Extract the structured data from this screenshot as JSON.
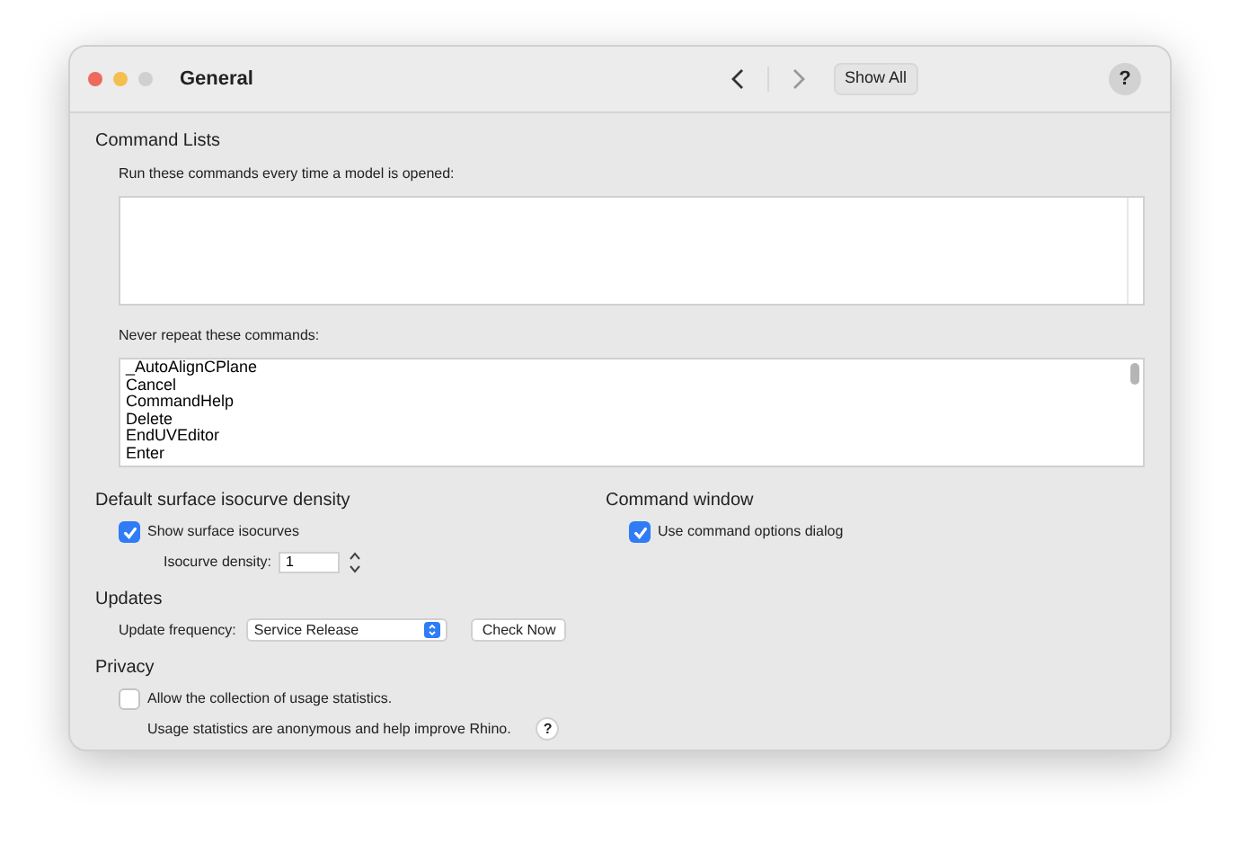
{
  "window": {
    "title": "General",
    "show_all": "Show All",
    "help": "?"
  },
  "command_lists": {
    "title": "Command Lists",
    "startup_label": "Run these commands every time a model is opened:",
    "never_label": "Never repeat these commands:",
    "never_items": [
      "_AutoAlignCPlane",
      "Cancel",
      "CommandHelp",
      "Delete",
      "EndUVEditor",
      "Enter"
    ]
  },
  "isocurve": {
    "title": "Default surface isocurve density",
    "show_label": "Show surface isocurves",
    "show_checked": true,
    "density_label": "Isocurve density:",
    "density_value": "1"
  },
  "command_window": {
    "title": "Command window",
    "options_label": "Use command options dialog",
    "options_checked": true
  },
  "updates": {
    "title": "Updates",
    "frequency_label": "Update frequency:",
    "frequency_value": "Service Release",
    "check_now": "Check Now"
  },
  "privacy": {
    "title": "Privacy",
    "allow_label": "Allow the collection of usage statistics.",
    "allow_checked": false,
    "note": "Usage statistics are anonymous and help improve Rhino.",
    "help": "?"
  }
}
